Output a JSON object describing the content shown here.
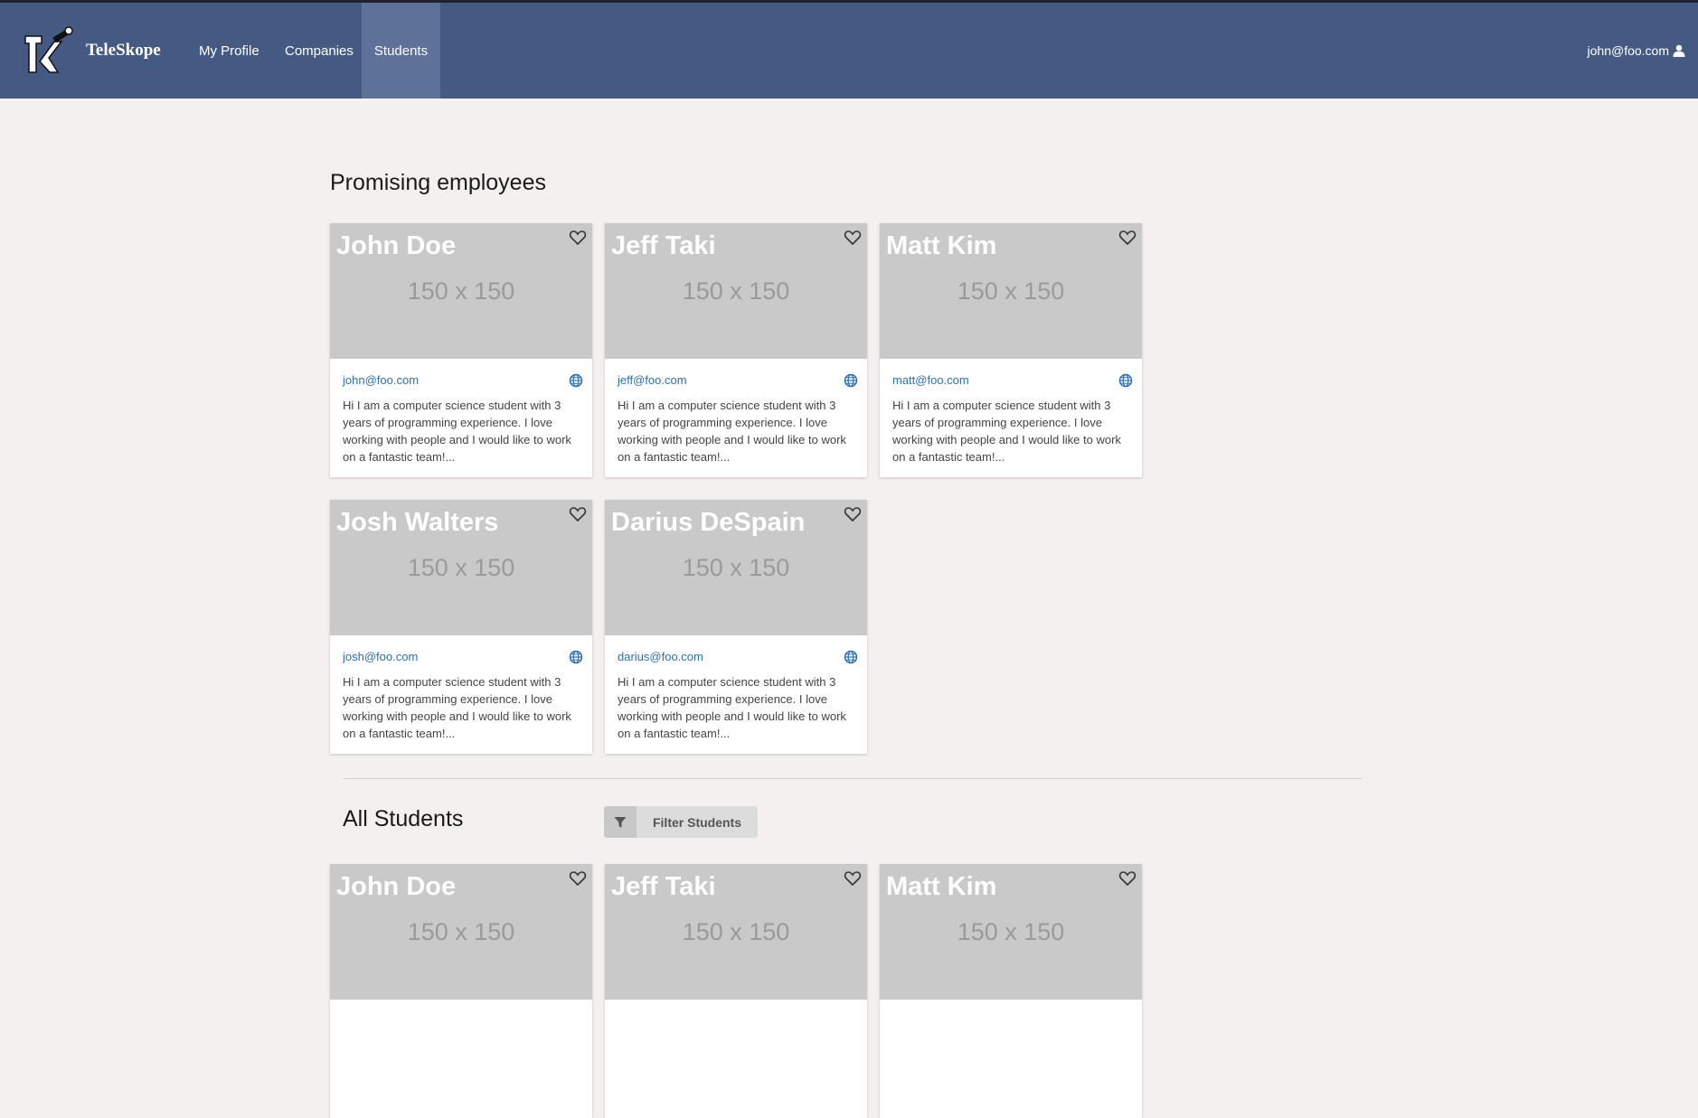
{
  "nav": {
    "brand": "TeleSkope",
    "items": [
      {
        "label": "My Profile"
      },
      {
        "label": "Companies"
      },
      {
        "label": "Students"
      }
    ],
    "user_email": "john@foo.com"
  },
  "promising": {
    "title": "Promising employees",
    "cards": [
      {
        "name": "John Doe",
        "email": "john@foo.com",
        "placeholder": "150 x 150",
        "bio": "Hi I am a computer science student with 3 years of programming experience. I love working with people and I would like to work on a fantastic team!..."
      },
      {
        "name": "Jeff Taki",
        "email": "jeff@foo.com",
        "placeholder": "150 x 150",
        "bio": "Hi I am a computer science student with 3 years of programming experience. I love working with people and I would like to work on a fantastic team!..."
      },
      {
        "name": "Matt Kim",
        "email": "matt@foo.com",
        "placeholder": "150 x 150",
        "bio": "Hi I am a computer science student with 3 years of programming experience. I love working with people and I would like to work on a fantastic team!..."
      },
      {
        "name": "Josh Walters",
        "email": "josh@foo.com",
        "placeholder": "150 x 150",
        "bio": "Hi I am a computer science student with 3 years of programming experience. I love working with people and I would like to work on a fantastic team!..."
      },
      {
        "name": "Darius DeSpain",
        "email": "darius@foo.com",
        "placeholder": "150 x 150",
        "bio": "Hi I am a computer science student with 3 years of programming experience. I love working with people and I would like to work on a fantastic team!..."
      }
    ]
  },
  "all_students": {
    "title": "All Students",
    "filter_label": "Filter Students",
    "cards": [
      {
        "name": "John Doe",
        "placeholder": "150 x 150"
      },
      {
        "name": "Jeff Taki",
        "placeholder": "150 x 150"
      },
      {
        "name": "Matt Kim",
        "placeholder": "150 x 150"
      }
    ]
  },
  "colors": {
    "navbar": "#455a83",
    "nav_active": "#5e7199",
    "page_bg": "#f4f0ef",
    "link": "#2b6fb6",
    "photo_placeholder": "#c9c9c9"
  },
  "icons": {
    "favorite": "heart-outline-icon",
    "website": "globe-icon",
    "user": "user-icon",
    "filter": "filter-icon"
  }
}
